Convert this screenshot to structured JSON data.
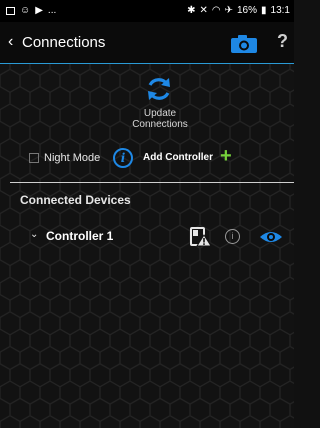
{
  "status_bar": {
    "ellipsis": "...",
    "battery": "16%",
    "time": "13:1"
  },
  "header": {
    "back_glyph": "‹",
    "title": "Connections",
    "help_glyph": "?"
  },
  "update": {
    "line1": "Update",
    "line2": "Connections"
  },
  "controls": {
    "night_mode_label": "Night Mode",
    "night_mode_checked": false,
    "info_glyph": "i",
    "add_controller_label": "Add Controller",
    "add_glyph": "+"
  },
  "devices": {
    "section_title": "Connected Devices",
    "items": [
      {
        "name": "Controller 1",
        "expand_glyph": "⌄",
        "info_glyph": "i"
      }
    ]
  },
  "colors": {
    "accent_blue": "#1e88e5",
    "header_divider": "#2b9bd6",
    "add_green": "#76d13b"
  },
  "icons": [
    "camera-icon",
    "refresh-icon",
    "info-icon",
    "plus-icon",
    "warning-icon",
    "eye-icon"
  ]
}
